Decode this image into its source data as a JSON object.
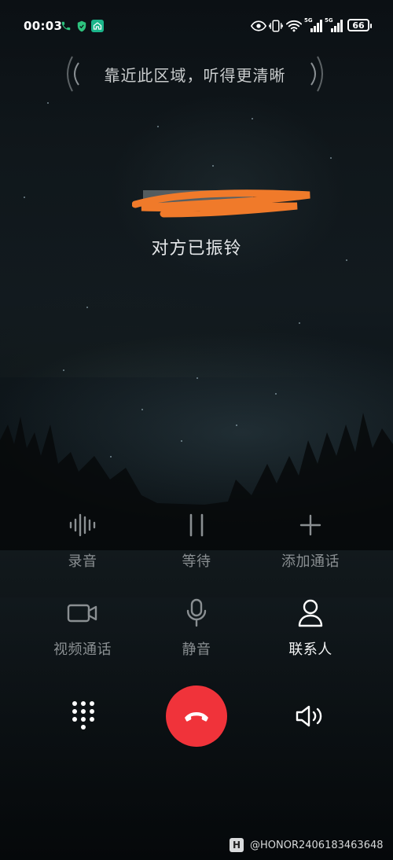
{
  "status_bar": {
    "time": "00:03",
    "network_gen_1": "5G",
    "network_gen_2": "5G",
    "battery_level": "66",
    "icons": [
      "phone-call-icon",
      "shield-icon",
      "home-app-icon",
      "eye-icon",
      "vibrate-icon",
      "wifi-icon",
      "signal-icon",
      "signal-icon",
      "battery-icon"
    ]
  },
  "earpiece_hint": "靠近此区域，听得更清晰",
  "call": {
    "status": "对方已振铃"
  },
  "actions": {
    "record": "录音",
    "hold": "等待",
    "add_call": "添加通话",
    "video_call": "视频通话",
    "mute": "静音",
    "contacts": "联系人"
  },
  "bottom": {
    "keypad_icon": "keypad-icon",
    "hangup_icon": "hang-up-icon",
    "speaker_icon": "speaker-icon"
  },
  "colors": {
    "hangup": "#f0333a",
    "disabled_label": "#8a8f92",
    "active_label": "#f2f3f4"
  },
  "watermark": {
    "logo": "H",
    "text": "@HONOR2406183463648"
  }
}
